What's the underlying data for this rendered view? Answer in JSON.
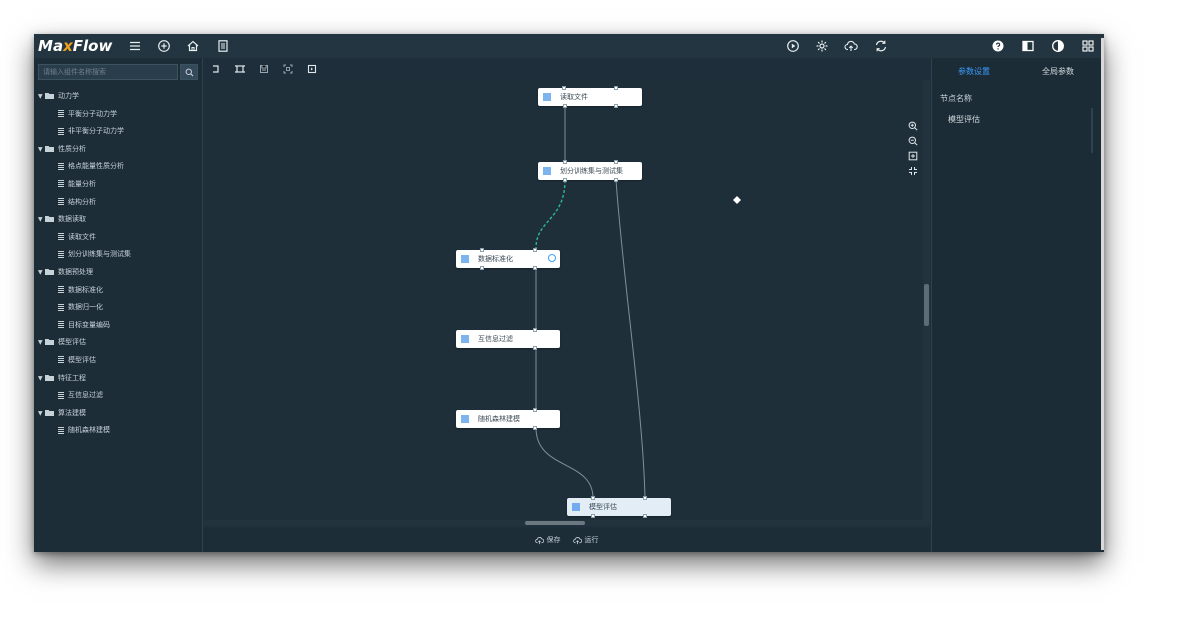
{
  "app": {
    "logo_prefix": "M",
    "logo_a": "a",
    "logo_x": "x",
    "logo_suffix": "Flow"
  },
  "colors": {
    "accent": "#3b9cff",
    "logo_x": "#f0a020",
    "edge_active": "#2bb3a0",
    "background": "#1e2f3b"
  },
  "topbar": {
    "left_icons": [
      "menu-icon",
      "add-circle-icon",
      "home-icon",
      "document-icon"
    ],
    "center_icons": [
      "play-circle-icon",
      "settings-gear-icon",
      "cloud-upload-icon",
      "refresh-icon"
    ],
    "right_icons": [
      "help-icon",
      "layout-panel-icon",
      "contrast-icon",
      "grid-apps-icon"
    ]
  },
  "sidebar": {
    "search_placeholder": "请输入组件名称搜索",
    "tree": [
      {
        "type": "folder",
        "label": "动力学"
      },
      {
        "type": "leaf",
        "label": "平衡分子动力学"
      },
      {
        "type": "leaf",
        "label": "非平衡分子动力学"
      },
      {
        "type": "folder",
        "label": "性质分析"
      },
      {
        "type": "leaf",
        "label": "格点能量性质分析"
      },
      {
        "type": "leaf",
        "label": "能量分析"
      },
      {
        "type": "leaf",
        "label": "结构分析"
      },
      {
        "type": "folder",
        "label": "数据读取"
      },
      {
        "type": "leaf",
        "label": "读取文件"
      },
      {
        "type": "leaf",
        "label": "划分训练集与测试集"
      },
      {
        "type": "folder",
        "label": "数据预处理"
      },
      {
        "type": "leaf",
        "label": "数据标准化"
      },
      {
        "type": "leaf",
        "label": "数据归一化"
      },
      {
        "type": "leaf",
        "label": "目标变量编码"
      },
      {
        "type": "folder",
        "label": "模型评估"
      },
      {
        "type": "leaf",
        "label": "模型评估"
      },
      {
        "type": "folder",
        "label": "特征工程"
      },
      {
        "type": "leaf",
        "label": "互信息过滤"
      },
      {
        "type": "folder",
        "label": "算法建模"
      },
      {
        "type": "leaf",
        "label": "随机森林建模"
      }
    ]
  },
  "canvas_toolbar": {
    "icons": [
      "undo-icon",
      "crop-icon",
      "save-icon",
      "fullscreen-icon",
      "export-icon"
    ]
  },
  "flow": {
    "nodes": [
      {
        "id": "n1",
        "label": "读取文件"
      },
      {
        "id": "n2",
        "label": "划分训练集与测试集"
      },
      {
        "id": "n3",
        "label": "数据标准化"
      },
      {
        "id": "n4",
        "label": "互信息过滤"
      },
      {
        "id": "n5",
        "label": "随机森林建模"
      },
      {
        "id": "n6",
        "label": "模型评估"
      }
    ]
  },
  "zoom_controls": [
    "zoom-in-icon",
    "zoom-out-icon",
    "fit-view-icon",
    "collapse-icon"
  ],
  "bottombar": {
    "save_label": "保存",
    "run_label": "运行"
  },
  "rightpanel": {
    "tab_params": "参数设置",
    "tab_global": "全局参数",
    "node_name_label": "节点名称",
    "node_name_value": "模型评估"
  }
}
